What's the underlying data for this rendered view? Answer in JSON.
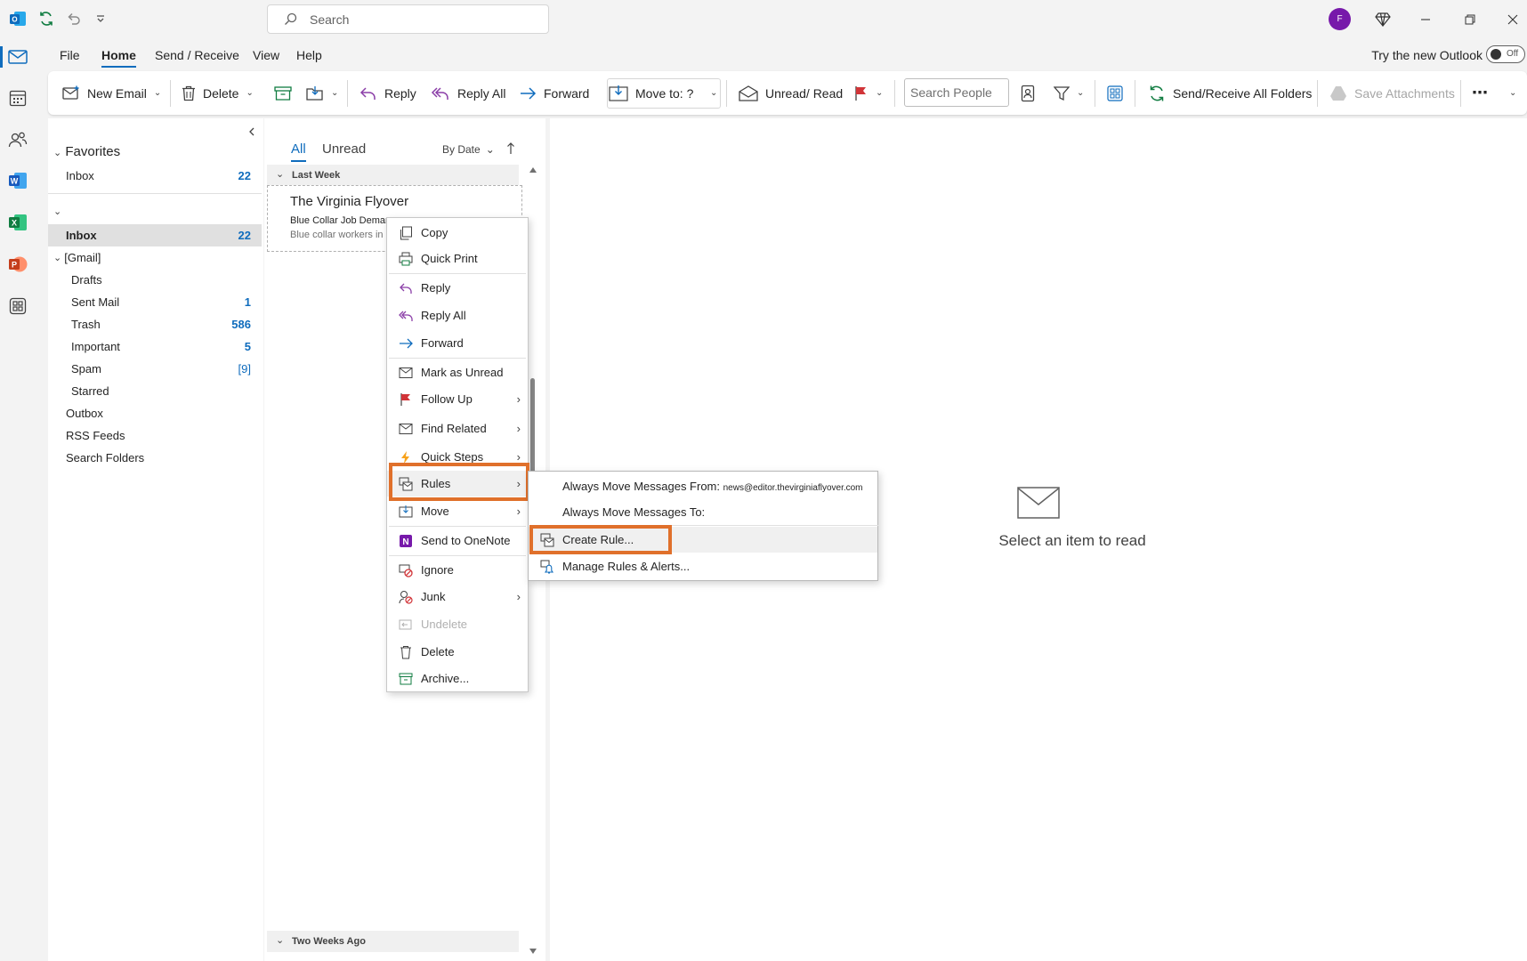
{
  "titlebar": {
    "search_placeholder": "Search",
    "avatar_initial": "F"
  },
  "menubar": {
    "tabs": [
      "File",
      "Home",
      "Send / Receive",
      "View",
      "Help"
    ],
    "try_new": "Try the new Outlook",
    "toggle": "Off"
  },
  "ribbon": {
    "new_email": "New Email",
    "delete": "Delete",
    "reply": "Reply",
    "reply_all": "Reply All",
    "forward": "Forward",
    "move_to": "Move to: ?",
    "unread_read": "Unread/ Read",
    "search_people": "Search People",
    "send_receive_all": "Send/Receive All Folders",
    "save_attachments": "Save Attachments",
    "more": "⋯"
  },
  "folders": {
    "favorites_label": "Favorites",
    "fav_inbox": "Inbox",
    "fav_inbox_count": "22",
    "inbox": "Inbox",
    "inbox_count": "22",
    "gmail": "[Gmail]",
    "items": [
      {
        "label": "Drafts",
        "count": ""
      },
      {
        "label": "Sent Mail",
        "count": "1"
      },
      {
        "label": "Trash",
        "count": "586"
      },
      {
        "label": "Important",
        "count": "5"
      },
      {
        "label": "Spam",
        "count": "[9]"
      },
      {
        "label": "Starred",
        "count": ""
      }
    ],
    "outbox": "Outbox",
    "rss": "RSS Feeds",
    "search_folders": "Search Folders"
  },
  "msglist": {
    "tab_all": "All",
    "tab_unread": "Unread",
    "sort": "By Date",
    "group_last_week": "Last Week",
    "group_two_weeks": "Two Weeks Ago",
    "message": {
      "sender": "The Virginia Flyover",
      "subject": "Blue Collar Job Demar",
      "preview": "Blue collar workers in"
    }
  },
  "reading": {
    "empty_text": "Select an item to read"
  },
  "context_menu": {
    "items": [
      "Copy",
      "Quick Print",
      "Reply",
      "Reply All",
      "Forward",
      "Mark as Unread",
      "Follow Up",
      "Find Related",
      "Quick Steps",
      "Rules",
      "Move",
      "Send to OneNote",
      "Ignore",
      "Junk",
      "Undelete",
      "Delete",
      "Archive..."
    ]
  },
  "submenu": {
    "always_move_from": "Always Move Messages From:",
    "always_move_from_addr": "news@editor.thevirginiaflyover.com",
    "always_move_to": "Always Move Messages To:",
    "create_rule": "Create Rule...",
    "manage_rules": "Manage Rules & Alerts..."
  },
  "colors": {
    "accent": "#0f6cbd",
    "highlight": "#e0702b",
    "avatar": "#7719aa"
  }
}
